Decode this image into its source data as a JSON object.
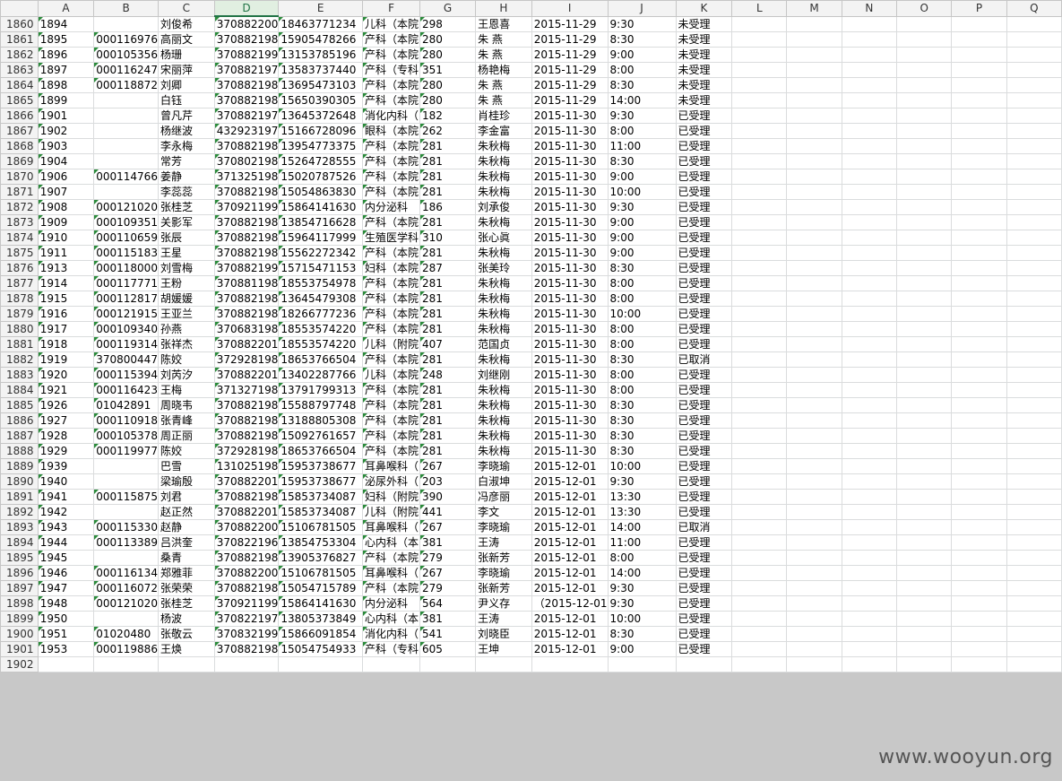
{
  "columns": [
    "A",
    "B",
    "C",
    "D",
    "E",
    "F",
    "G",
    "H",
    "I",
    "J",
    "K",
    "L",
    "M",
    "N",
    "O",
    "P",
    "Q"
  ],
  "selected_column": "D",
  "rows": [
    {
      "r": "1860",
      "c": [
        "1894",
        "",
        "刘俊希",
        "370882200",
        "18463771234",
        "儿科（本院",
        "298",
        "王恩喜",
        "2015-11-29",
        "9:30",
        "未受理"
      ]
    },
    {
      "r": "1861",
      "c": [
        "1895",
        "000116976",
        "高丽文",
        "370882198",
        "15905478266",
        "产科（本院",
        "280",
        "朱 燕",
        "2015-11-29",
        "8:30",
        "未受理"
      ]
    },
    {
      "r": "1862",
      "c": [
        "1896",
        "000105356",
        "杨珊",
        "370882199",
        "13153785196",
        "产科（本院",
        "280",
        "朱 燕",
        "2015-11-29",
        "9:00",
        "未受理"
      ]
    },
    {
      "r": "1863",
      "c": [
        "1897",
        "000116247",
        "宋丽萍",
        "370882197",
        "13583737440",
        "产科（专科",
        "351",
        "杨艳梅",
        "2015-11-29",
        "8:00",
        "未受理"
      ]
    },
    {
      "r": "1864",
      "c": [
        "1898",
        "000118872",
        "刘卿",
        "370882198",
        "13695473103",
        "产科（本院",
        "280",
        "朱 燕",
        "2015-11-29",
        "8:30",
        "未受理"
      ]
    },
    {
      "r": "1865",
      "c": [
        "1899",
        "",
        "白钰",
        "370882198",
        "15650390305",
        "产科（本院",
        "280",
        "朱 燕",
        "2015-11-29",
        "14:00",
        "未受理"
      ]
    },
    {
      "r": "1866",
      "c": [
        "1901",
        "",
        "曾凡芹",
        "370882197",
        "13645372648",
        "消化内科（",
        "182",
        "肖桂珍",
        "2015-11-30",
        "9:30",
        "已受理"
      ]
    },
    {
      "r": "1867",
      "c": [
        "1902",
        "",
        "杨继波",
        "432923197",
        "15166728096",
        "眼科（本院",
        "262",
        "李金富",
        "2015-11-30",
        "8:00",
        "已受理"
      ]
    },
    {
      "r": "1868",
      "c": [
        "1903",
        "",
        "李永梅",
        "370882198",
        "13954773375",
        "产科（本院",
        "281",
        "朱秋梅",
        "2015-11-30",
        "11:00",
        "已受理"
      ]
    },
    {
      "r": "1869",
      "c": [
        "1904",
        "",
        "常芳",
        "370802198",
        "15264728555",
        "产科（本院",
        "281",
        "朱秋梅",
        "2015-11-30",
        "8:30",
        "已受理"
      ]
    },
    {
      "r": "1870",
      "c": [
        "1906",
        "000114766",
        "姜静",
        "371325198",
        "15020787526",
        "产科（本院",
        "281",
        "朱秋梅",
        "2015-11-30",
        "9:00",
        "已受理"
      ]
    },
    {
      "r": "1871",
      "c": [
        "1907",
        "",
        "李蕊蕊",
        "370882198",
        "15054863830",
        "产科（本院",
        "281",
        "朱秋梅",
        "2015-11-30",
        "10:00",
        "已受理"
      ]
    },
    {
      "r": "1872",
      "c": [
        "1908",
        "000121020",
        "张桂芝",
        "370921199",
        "15864141630",
        "内分泌科",
        "186",
        "刘承俊",
        "2015-11-30",
        "9:30",
        "已受理"
      ]
    },
    {
      "r": "1873",
      "c": [
        "1909",
        "000109351",
        "关影军",
        "370882198",
        "13854716628",
        "产科（本院",
        "281",
        "朱秋梅",
        "2015-11-30",
        "9:00",
        "已受理"
      ]
    },
    {
      "r": "1874",
      "c": [
        "1910",
        "000110659",
        "张辰",
        "370882198",
        "15964117999",
        "生殖医学科",
        "310",
        "张心眞",
        "2015-11-30",
        "9:00",
        "已受理"
      ]
    },
    {
      "r": "1875",
      "c": [
        "1911",
        "000115183",
        "王星",
        "370882198",
        "15562272342",
        "产科（本院",
        "281",
        "朱秋梅",
        "2015-11-30",
        "9:00",
        "已受理"
      ]
    },
    {
      "r": "1876",
      "c": [
        "1913",
        "000118000",
        "刘雪梅",
        "370882199",
        "15715471153",
        "妇科（本院",
        "287",
        "张美玲",
        "2015-11-30",
        "8:30",
        "已受理"
      ]
    },
    {
      "r": "1877",
      "c": [
        "1914",
        "000117771",
        "王粉",
        "370881198",
        "18553754978",
        "产科（本院",
        "281",
        "朱秋梅",
        "2015-11-30",
        "8:00",
        "已受理"
      ]
    },
    {
      "r": "1878",
      "c": [
        "1915",
        "000112817",
        "胡媛媛",
        "370882198",
        "13645479308",
        "产科（本院",
        "281",
        "朱秋梅",
        "2015-11-30",
        "8:00",
        "已受理"
      ]
    },
    {
      "r": "1879",
      "c": [
        "1916",
        "000121915",
        "王亚兰",
        "370882198",
        "18266777236",
        "产科（本院",
        "281",
        "朱秋梅",
        "2015-11-30",
        "10:00",
        "已受理"
      ]
    },
    {
      "r": "1880",
      "c": [
        "1917",
        "000109340",
        "孙燕",
        "370683198",
        "18553574220",
        "产科（本院",
        "281",
        "朱秋梅",
        "2015-11-30",
        "8:00",
        "已受理"
      ]
    },
    {
      "r": "1881",
      "c": [
        "1918",
        "000119314",
        "张祥杰",
        "370882201",
        "18553574220",
        "儿科（附院",
        "407",
        "范国贞",
        "2015-11-30",
        "8:00",
        "已受理"
      ]
    },
    {
      "r": "1882",
      "c": [
        "1919",
        "370800447",
        "陈姣",
        "372928198",
        "18653766504",
        "产科（本院",
        "281",
        "朱秋梅",
        "2015-11-30",
        "8:30",
        "已取消"
      ]
    },
    {
      "r": "1883",
      "c": [
        "1920",
        "000115394",
        "刘芮汐",
        "370882201",
        "13402287766",
        "儿科（本院",
        "248",
        "刘继刚",
        "2015-11-30",
        "8:00",
        "已受理"
      ]
    },
    {
      "r": "1884",
      "c": [
        "1921",
        "000116423",
        "王梅",
        "371327198",
        "13791799313",
        "产科（本院",
        "281",
        "朱秋梅",
        "2015-11-30",
        "8:00",
        "已受理"
      ]
    },
    {
      "r": "1885",
      "c": [
        "1926",
        "01042891",
        "周晓韦",
        "370882198",
        "15588797748",
        "产科（本院",
        "281",
        "朱秋梅",
        "2015-11-30",
        "8:30",
        "已受理"
      ]
    },
    {
      "r": "1886",
      "c": [
        "1927",
        "000110918",
        "张青峰",
        "370882198",
        "13188805308",
        "产科（本院",
        "281",
        "朱秋梅",
        "2015-11-30",
        "8:30",
        "已受理"
      ]
    },
    {
      "r": "1887",
      "c": [
        "1928",
        "000105378",
        "周正丽",
        "370882198",
        "15092761657",
        "产科（本院",
        "281",
        "朱秋梅",
        "2015-11-30",
        "8:30",
        "已受理"
      ]
    },
    {
      "r": "1888",
      "c": [
        "1929",
        "000119977",
        "陈姣",
        "372928198",
        "18653766504",
        "产科（本院",
        "281",
        "朱秋梅",
        "2015-11-30",
        "8:30",
        "已受理"
      ]
    },
    {
      "r": "1889",
      "c": [
        "1939",
        "",
        "巴雪",
        "131025198",
        "15953738677",
        "耳鼻喉科（",
        "267",
        "李晓瑜",
        "2015-12-01",
        "10:00",
        "已受理"
      ]
    },
    {
      "r": "1890",
      "c": [
        "1940",
        "",
        "梁瑜殷",
        "370882201",
        "15953738677",
        "泌尿外科（",
        "203",
        "白淑坤",
        "2015-12-01",
        "9:30",
        "已受理"
      ]
    },
    {
      "r": "1891",
      "c": [
        "1941",
        "000115875",
        "刘君",
        "370882198",
        "15853734087",
        "妇科（附院",
        "390",
        "冯彦丽",
        "2015-12-01",
        "13:30",
        "已受理"
      ]
    },
    {
      "r": "1892",
      "c": [
        "1942",
        "",
        "赵正然",
        "370882201",
        "15853734087",
        "儿科（附院",
        "441",
        "李文",
        "2015-12-01",
        "13:30",
        "已受理"
      ]
    },
    {
      "r": "1893",
      "c": [
        "1943",
        "000115330",
        "赵静",
        "370882200",
        "15106781505",
        "耳鼻喉科（",
        "267",
        "李晓瑜",
        "2015-12-01",
        "14:00",
        "已取消"
      ]
    },
    {
      "r": "1894",
      "c": [
        "1944",
        "000113389",
        "吕洪奎",
        "370822196",
        "13854753304",
        "心内科（本",
        "381",
        "王涛",
        "2015-12-01",
        "11:00",
        "已受理"
      ]
    },
    {
      "r": "1895",
      "c": [
        "1945",
        "",
        "桑青",
        "370882198",
        "13905376827",
        "产科（本院",
        "279",
        "张新芳",
        "2015-12-01",
        "8:00",
        "已受理"
      ]
    },
    {
      "r": "1896",
      "c": [
        "1946",
        "000116134",
        "郑雅菲",
        "370882200",
        "15106781505",
        "耳鼻喉科（",
        "267",
        "李晓瑜",
        "2015-12-01",
        "14:00",
        "已受理"
      ]
    },
    {
      "r": "1897",
      "c": [
        "1947",
        "000116072",
        "张荣荣",
        "370882198",
        "15054715789",
        "产科（本院",
        "279",
        "张新芳",
        "2015-12-01",
        "9:30",
        "已受理"
      ]
    },
    {
      "r": "1898",
      "c": [
        "1948",
        "000121020",
        "张桂芝",
        "370921199",
        "15864141630",
        "内分泌科",
        "564",
        "尹义存",
        "（2015-12-01",
        "9:30",
        "已受理"
      ]
    },
    {
      "r": "1899",
      "c": [
        "1950",
        "",
        "杨波",
        "370822197",
        "13805373849",
        "心内科（本",
        "381",
        "王涛",
        "2015-12-01",
        "10:00",
        "已受理"
      ]
    },
    {
      "r": "1900",
      "c": [
        "1951",
        "01020480",
        "张敬云",
        "370832199",
        "15866091854",
        "消化内科（",
        "541",
        "刘晓臣",
        "2015-12-01",
        "8:30",
        "已受理"
      ]
    },
    {
      "r": "1901",
      "c": [
        "1953",
        "000119886",
        "王焕",
        "370882198",
        "15054754933",
        "产科（专科",
        "605",
        "王坤",
        "2015-12-01",
        "9:00",
        "已受理"
      ]
    },
    {
      "r": "1902",
      "c": [
        "",
        "",
        "",
        "",
        "",
        "",
        "",
        "",
        "",
        "",
        ""
      ]
    }
  ],
  "watermark": "www.wooyun.org"
}
